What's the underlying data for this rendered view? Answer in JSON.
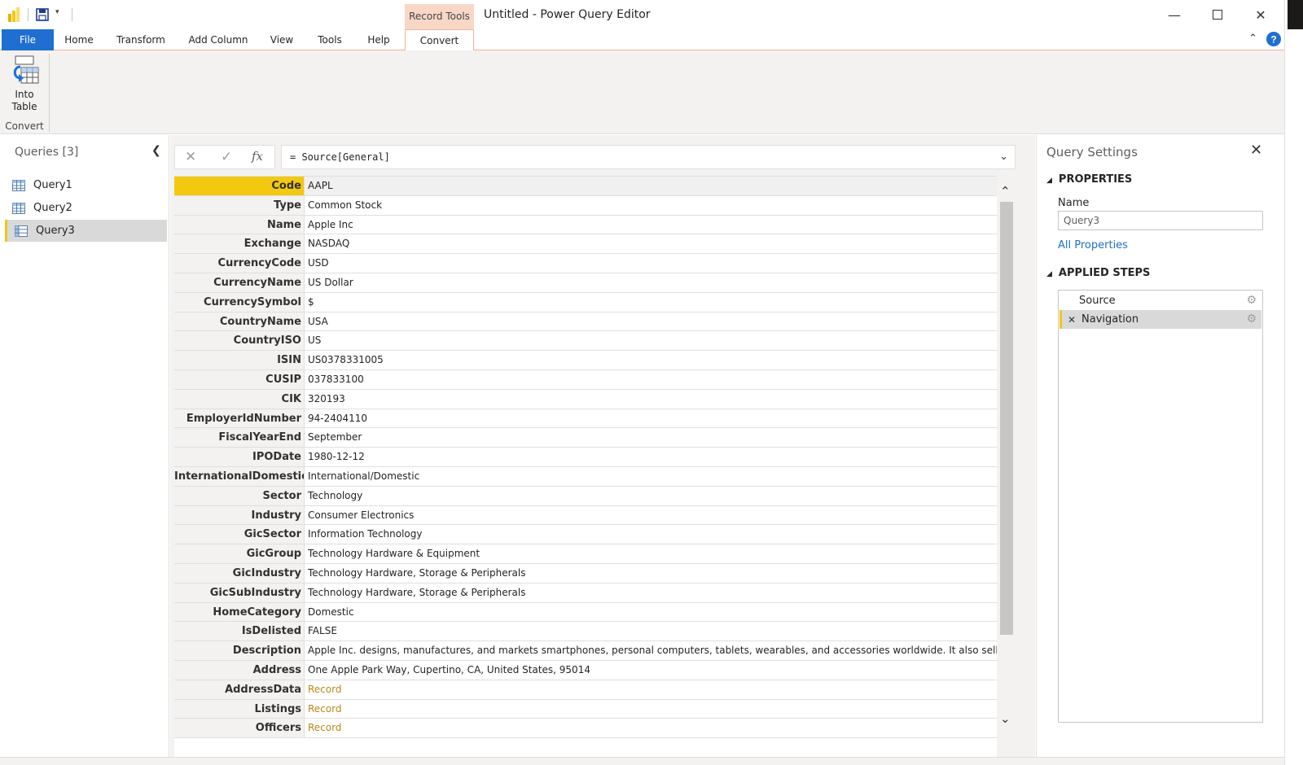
{
  "window": {
    "title": "Untitled - Power Query Editor",
    "context_tab": "Record Tools"
  },
  "ribbon": {
    "tabs": [
      "File",
      "Home",
      "Transform",
      "Add Column",
      "View",
      "Tools",
      "Help",
      "Convert"
    ],
    "active_tab": "Convert",
    "into_table_line1": "Into",
    "into_table_line2": "Table",
    "group_label": "Convert"
  },
  "queries": {
    "title": "Queries [3]",
    "items": [
      "Query1",
      "Query2",
      "Query3"
    ],
    "selected": "Query3"
  },
  "formula": {
    "text": "= Source[General]"
  },
  "record": {
    "rows": [
      {
        "k": "Code",
        "v": "AAPL"
      },
      {
        "k": "Type",
        "v": "Common Stock"
      },
      {
        "k": "Name",
        "v": "Apple Inc"
      },
      {
        "k": "Exchange",
        "v": "NASDAQ"
      },
      {
        "k": "CurrencyCode",
        "v": "USD"
      },
      {
        "k": "CurrencyName",
        "v": "US Dollar"
      },
      {
        "k": "CurrencySymbol",
        "v": "$"
      },
      {
        "k": "CountryName",
        "v": "USA"
      },
      {
        "k": "CountryISO",
        "v": "US"
      },
      {
        "k": "ISIN",
        "v": "US0378331005"
      },
      {
        "k": "CUSIP",
        "v": "037833100"
      },
      {
        "k": "CIK",
        "v": "320193"
      },
      {
        "k": "EmployerIdNumber",
        "v": "94-2404110"
      },
      {
        "k": "FiscalYearEnd",
        "v": "September"
      },
      {
        "k": "IPODate",
        "v": "1980-12-12"
      },
      {
        "k": "InternationalDomestic",
        "v": "International/Domestic"
      },
      {
        "k": "Sector",
        "v": "Technology"
      },
      {
        "k": "Industry",
        "v": "Consumer Electronics"
      },
      {
        "k": "GicSector",
        "v": "Information Technology"
      },
      {
        "k": "GicGroup",
        "v": "Technology Hardware & Equipment"
      },
      {
        "k": "GicIndustry",
        "v": "Technology Hardware, Storage & Peripherals"
      },
      {
        "k": "GicSubIndustry",
        "v": "Technology Hardware, Storage & Peripherals"
      },
      {
        "k": "HomeCategory",
        "v": "Domestic"
      },
      {
        "k": "IsDelisted",
        "v": "FALSE"
      },
      {
        "k": "Description",
        "v": "Apple Inc. designs, manufactures, and markets smartphones, personal computers, tablets, wearables, and accessories worldwide. It also sells various r..."
      },
      {
        "k": "Address",
        "v": "One Apple Park Way, Cupertino, CA, United States, 95014"
      },
      {
        "k": "AddressData",
        "v": "Record",
        "record": true
      },
      {
        "k": "Listings",
        "v": "Record",
        "record": true
      },
      {
        "k": "Officers",
        "v": "Record",
        "record": true
      }
    ]
  },
  "settings": {
    "title": "Query Settings",
    "properties_heading": "PROPERTIES",
    "name_label": "Name",
    "name_value": "Query3",
    "all_properties": "All Properties",
    "steps_heading": "APPLIED STEPS",
    "steps": [
      "Source",
      "Navigation"
    ],
    "selected_step": "Navigation"
  },
  "colors": {
    "accent_blue": "#1f6fd1",
    "selection_yellow": "#f2c811",
    "record_link": "#b78a1a",
    "context_tab_bg": "#f9d7c7"
  }
}
